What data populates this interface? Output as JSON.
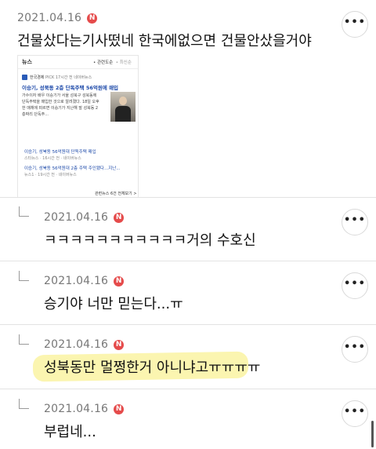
{
  "post": {
    "date": "2021.04.16",
    "badge": "N",
    "text": "건물샀다는기사떴네 한국에없으면 건물안샀을거야",
    "more": "•••",
    "embed": {
      "header": "뉴스",
      "sort_relevance": "• 관련도순",
      "sort_latest": "• 최신순",
      "source": "한국경제",
      "source_pick": "PICK",
      "source_time": "17시간 전",
      "source_naver": "네이버뉴스",
      "headline": "이승기, 성북동 2층 단독주택 56억원에 매입",
      "snippet": "가수이자 배우 이승기가 서울 성북구 성북동에 단독주택을 매입한 것으로 알려졌다. 18일 오후 한 매체에 따르면 이승기가 지난해 말 성북동 2층짜리 단독주...",
      "related": [
        {
          "title": "이승기, 성북동 56억원대 단독주택 매입",
          "meta": "스타뉴스 · 16시간 전 · 네이버뉴스"
        },
        {
          "title": "이승기, 성북동 56억원대 2층 주택 주인됐다...지난...",
          "meta": "뉴스1 · 19시간 전 · 네이버뉴스"
        }
      ],
      "more_link": "관련뉴스 6건 전체보기 >"
    }
  },
  "replies": [
    {
      "date": "2021.04.16",
      "badge": "N",
      "text": "ㅋㅋㅋㅋㅋㅋㅋㅋㅋㅋㅋ거의 수호신",
      "more": "•••"
    },
    {
      "date": "2021.04.16",
      "badge": "N",
      "text": "승기야 너만 믿는다...ㅠ",
      "more": "•••"
    },
    {
      "date": "2021.04.16",
      "badge": "N",
      "text": "성북동만 멀쩡한거 아니냐고ㅠㅠㅠㅠ",
      "more": "•••"
    },
    {
      "date": "2021.04.16",
      "badge": "N",
      "text": "부럽네...",
      "more": "•••"
    }
  ],
  "colors": {
    "badge": "#e54b4b",
    "highlight": "#fbf5b0",
    "date": "#777777"
  }
}
